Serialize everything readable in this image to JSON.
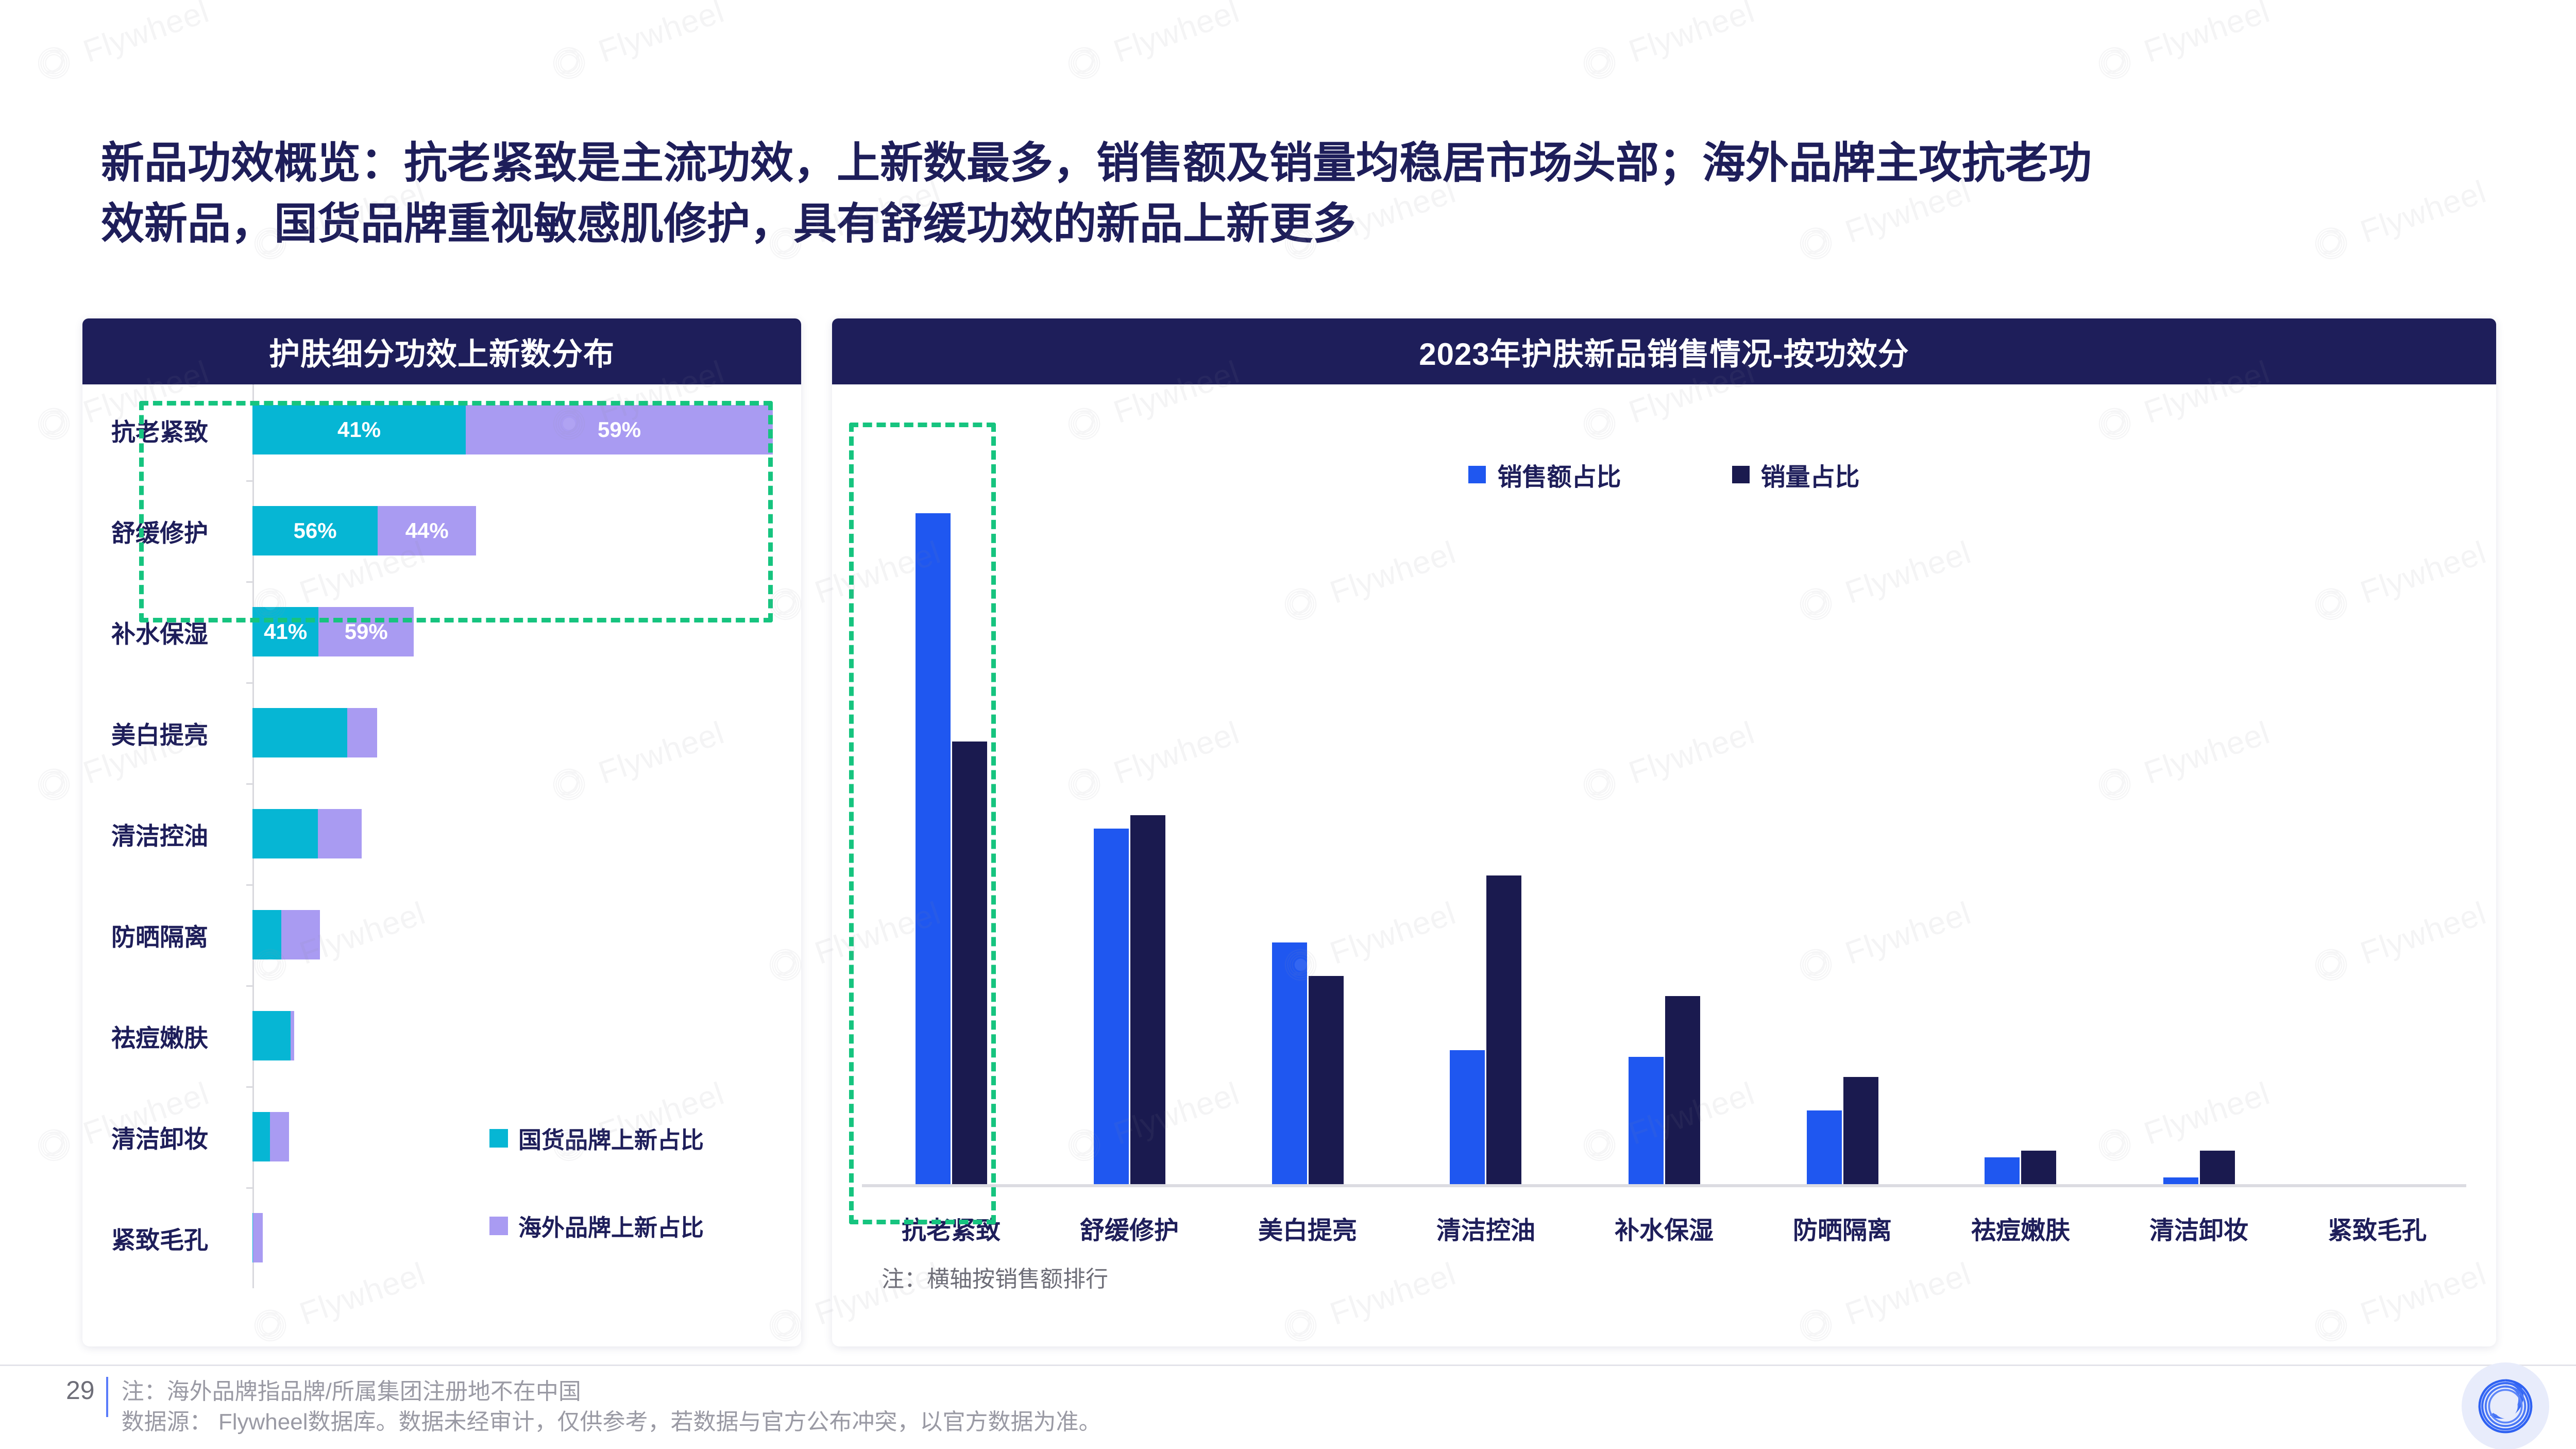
{
  "slide": {
    "title_lines": [
      "新品功效概览：抗老紧致是主流功效，上新数最多，销售额及销量均稳居市场头部；海外品牌主攻抗老功",
      "效新品，国货品牌重视敏感肌修护，具有舒缓功效的新品上新更多"
    ],
    "title_color": "#1E1E5A",
    "highlight_color": "#16C47F"
  },
  "footer": {
    "page_number": "29",
    "note_line": "注：海外品牌指品牌/所属集团注册地不在中国",
    "source_line": "数据源： Flywheel数据库。数据未经审计，仅供参考，若数据与官方公布冲突，以官方数据为准。",
    "logo_name": "flywheel-logo"
  },
  "watermark": {
    "text": "Flywheel"
  },
  "left_panel": {
    "header": "护肤细分功效上新数分布",
    "legend": [
      {
        "label": "国货品牌上新占比",
        "color": "#06B6D4",
        "key": "domestic"
      },
      {
        "label": "海外品牌上新占比",
        "color": "#A99BF2",
        "key": "overseas"
      }
    ]
  },
  "right_panel": {
    "header": "2023年护肤新品销售情况-按功效分",
    "note": "注：横轴按销售额排行",
    "legend": [
      {
        "label": "销售额占比",
        "color": "#1F57F0",
        "key": "sales_amount"
      },
      {
        "label": "销量占比",
        "color": "#1A1A4F",
        "key": "sales_volume"
      }
    ]
  },
  "chart_data": [
    {
      "type": "bar",
      "orientation": "horizontal",
      "stacked": true,
      "normalized": true,
      "title": "护肤细分功效上新数分布",
      "xlabel": "",
      "ylabel": "",
      "categories": [
        "抗老紧致",
        "舒缓修护",
        "补水保湿",
        "美白提亮",
        "清洁控油",
        "防晒隔离",
        "祛痘嫩肤",
        "清洁卸妆",
        "紧致毛孔"
      ],
      "series": [
        {
          "name": "国货品牌上新占比",
          "color": "#06B6D4",
          "values": [
            41,
            56,
            41,
            76,
            60,
            43,
            92,
            48,
            3
          ]
        },
        {
          "name": "海外品牌上新占比",
          "color": "#A99BF2",
          "values": [
            59,
            44,
            59,
            24,
            40,
            57,
            8,
            52,
            97
          ]
        }
      ],
      "bar_total_widths_pct": [
        100,
        43,
        31,
        24,
        21,
        13,
        8,
        7,
        2
      ],
      "data_labels": [
        {
          "category": "抗老紧致",
          "domestic": "41%",
          "overseas": "59%"
        },
        {
          "category": "舒缓修护",
          "domestic": "56%",
          "overseas": "44%"
        },
        {
          "category": "补水保湿",
          "domestic": "41%",
          "overseas": "59%"
        }
      ],
      "grid": false,
      "legend_position": "inside-right"
    },
    {
      "type": "bar",
      "orientation": "vertical",
      "grouped": true,
      "title": "2023年护肤新品销售情况-按功效分",
      "xlabel": "",
      "ylabel": "",
      "categories": [
        "抗老紧致",
        "舒缓修护",
        "美白提亮",
        "清洁控油",
        "补水保湿",
        "防晒隔离",
        "祛痘嫩肤",
        "清洁卸妆",
        "紧致毛孔"
      ],
      "series": [
        {
          "name": "销售额占比",
          "color": "#1F57F0",
          "values": [
            100,
            53,
            36,
            20,
            19,
            11,
            4,
            1,
            0
          ]
        },
        {
          "name": "销量占比",
          "color": "#1A1A4F",
          "values": [
            66,
            55,
            31,
            46,
            28,
            16,
            5,
            5,
            0
          ]
        }
      ],
      "grid": false,
      "legend_position": "top",
      "annotation": "注：横轴按销售额排行"
    }
  ]
}
